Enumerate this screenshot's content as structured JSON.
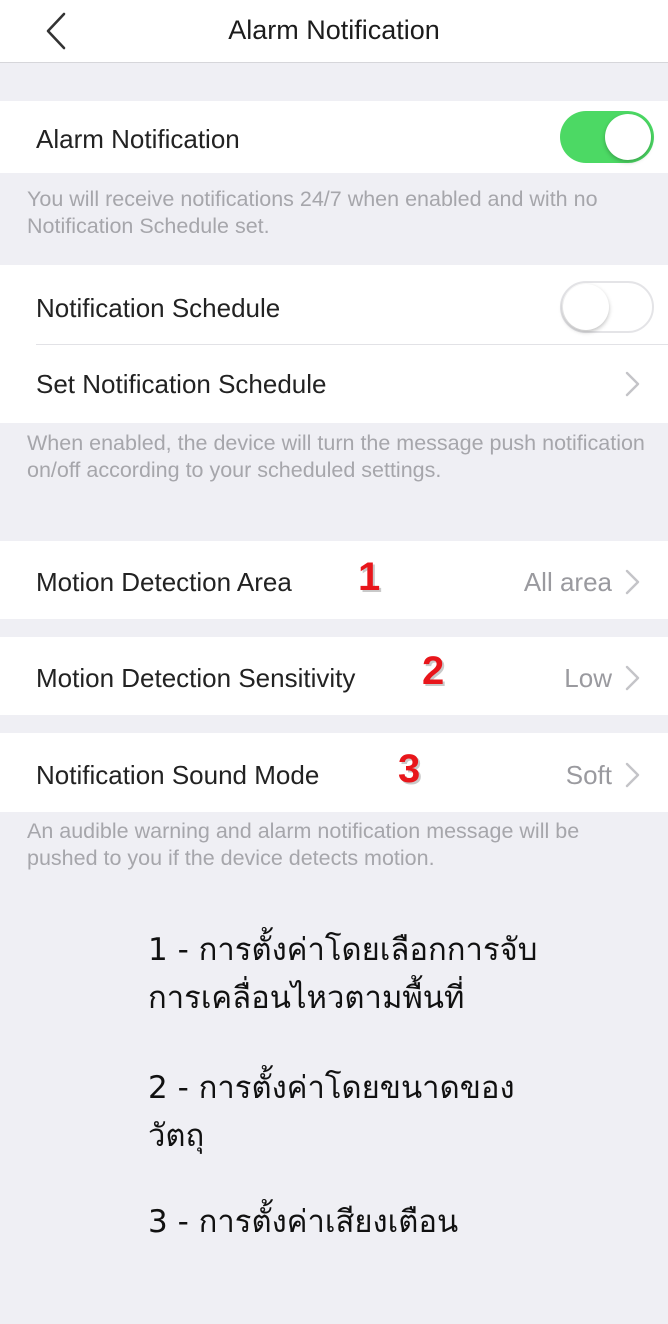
{
  "nav": {
    "title": "Alarm Notification"
  },
  "alarm": {
    "label": "Alarm Notification",
    "enabled": true,
    "note": "You will receive notifications 24/7 when enabled and with no Notification Schedule set."
  },
  "schedule": {
    "toggle_label": "Notification Schedule",
    "enabled": false,
    "set_label": "Set Notification Schedule",
    "note": "When enabled, the device will turn the message push notification on/off according to your scheduled settings."
  },
  "motion_area": {
    "label": "Motion Detection Area",
    "value": "All area",
    "marker": "1"
  },
  "motion_sensitivity": {
    "label": "Motion Detection Sensitivity",
    "value": "Low",
    "marker": "2"
  },
  "sound_mode": {
    "label": "Notification Sound Mode",
    "value": "Soft",
    "marker": "3",
    "note": "An audible warning and alarm notification message will be pushed to you if the device detects motion."
  },
  "annotations": {
    "line1a": "1 - การตั้งค่าโดยเลือกการจับ",
    "line1b": "การเคลื่อนไหวตามพื้นที่",
    "line2a": "2 - การตั้งค่าโดยขนาดของ",
    "line2b": "วัตถุ",
    "line3": "3 - การตั้งค่าเสียงเตือน"
  },
  "colors": {
    "toggle_on": "#4cd964",
    "marker": "#e8161b",
    "background": "#efeff4"
  }
}
